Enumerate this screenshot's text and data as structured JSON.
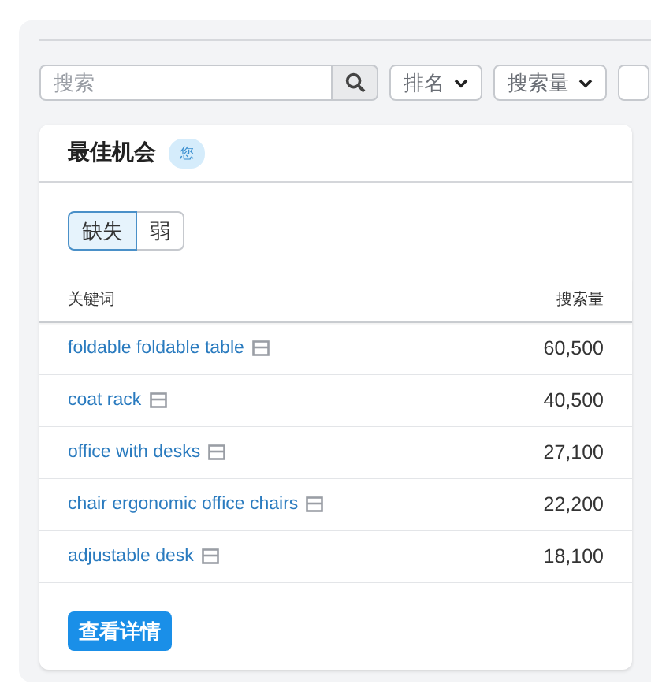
{
  "filters": {
    "search": {
      "placeholder": "搜索"
    },
    "dropdowns": [
      {
        "label": "排名"
      },
      {
        "label": "搜索量"
      }
    ]
  },
  "card": {
    "title": "最佳机会",
    "badge": "您",
    "segments": [
      {
        "label": "缺失",
        "selected": true
      },
      {
        "label": "弱",
        "selected": false
      }
    ],
    "table": {
      "columns": [
        "关键词",
        "搜索量"
      ],
      "rows": [
        {
          "keyword": "foldable foldable table",
          "volume": "60,500"
        },
        {
          "keyword": "coat rack",
          "volume": "40,500"
        },
        {
          "keyword": "office with desks",
          "volume": "27,100"
        },
        {
          "keyword": "chair ergonomic office chairs",
          "volume": "22,200"
        },
        {
          "keyword": "adjustable desk",
          "volume": "18,100"
        }
      ]
    },
    "button": "查看详情"
  }
}
